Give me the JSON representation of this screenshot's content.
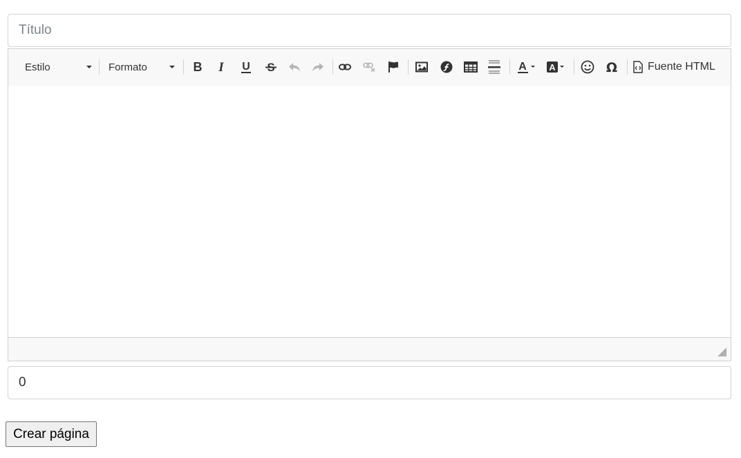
{
  "form": {
    "title_placeholder": "Título",
    "title_value": "",
    "count_value": "0",
    "submit_label": "Crear página"
  },
  "editor": {
    "style_combo": "Estilo",
    "format_combo": "Formato",
    "source_label": "Fuente HTML",
    "content": "",
    "toolbar_icons": [
      "bold-icon",
      "italic-icon",
      "underline-icon",
      "strikethrough-icon",
      "undo-icon",
      "redo-icon",
      "link-icon",
      "unlink-icon",
      "anchor-flag-icon",
      "image-icon",
      "flash-icon",
      "table-icon",
      "horizontal-rule-icon",
      "text-color-icon",
      "background-color-icon",
      "smiley-icon",
      "omega-icon",
      "source-icon"
    ]
  },
  "colors": {
    "toolbar_bg": "#f8f8f8",
    "border": "#d1d1d1",
    "icon": "#333333",
    "disabled_icon": "#b4b4b4"
  }
}
